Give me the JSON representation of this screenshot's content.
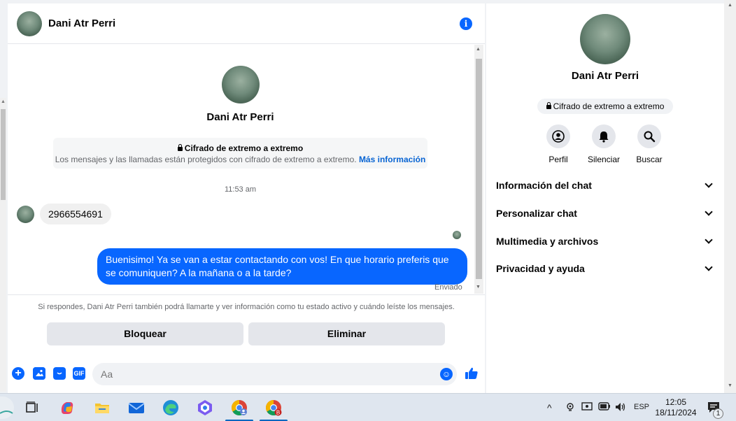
{
  "chat": {
    "contact_name": "Dani Atr Perri",
    "e2e_title": "Cifrado de extremo a extremo",
    "e2e_desc": "Los mensajes y las llamadas están protegidos con cifrado de extremo a extremo.",
    "e2e_link": "Más información",
    "time": "11:53 am",
    "incoming_message": "2966554691",
    "outgoing_message": "Buenisimo! Ya se van a estar contactando con vos! En que horario preferis que se comuniquen? A la mañana o a la tarde?",
    "status": "Enviado",
    "notice": "Si respondes, Dani Atr Perri también podrá llamarte y ver información como tu estado activo y cuándo leíste los mensajes.",
    "block_label": "Bloquear",
    "delete_label": "Eliminar",
    "input_placeholder": "Aa",
    "gif_label": "GIF"
  },
  "profile": {
    "name": "Dani Atr Perri",
    "badge": "Cifrado de extremo a extremo",
    "actions": [
      {
        "label": "Perfil",
        "icon": "profile-icon"
      },
      {
        "label": "Silenciar",
        "icon": "bell-icon"
      },
      {
        "label": "Buscar",
        "icon": "search-icon"
      }
    ],
    "sections": [
      {
        "label": "Información del chat"
      },
      {
        "label": "Personalizar chat"
      },
      {
        "label": "Multimedia y archivos"
      },
      {
        "label": "Privacidad y ayuda"
      }
    ]
  },
  "taskbar": {
    "language": "ESP",
    "time": "12:05",
    "date": "18/11/2024",
    "notification_count": "1",
    "chrome_badge": "B"
  },
  "colors": {
    "accent": "#0866ff",
    "bubble_in": "#f0f0f0",
    "button_bg": "#e4e6eb"
  }
}
